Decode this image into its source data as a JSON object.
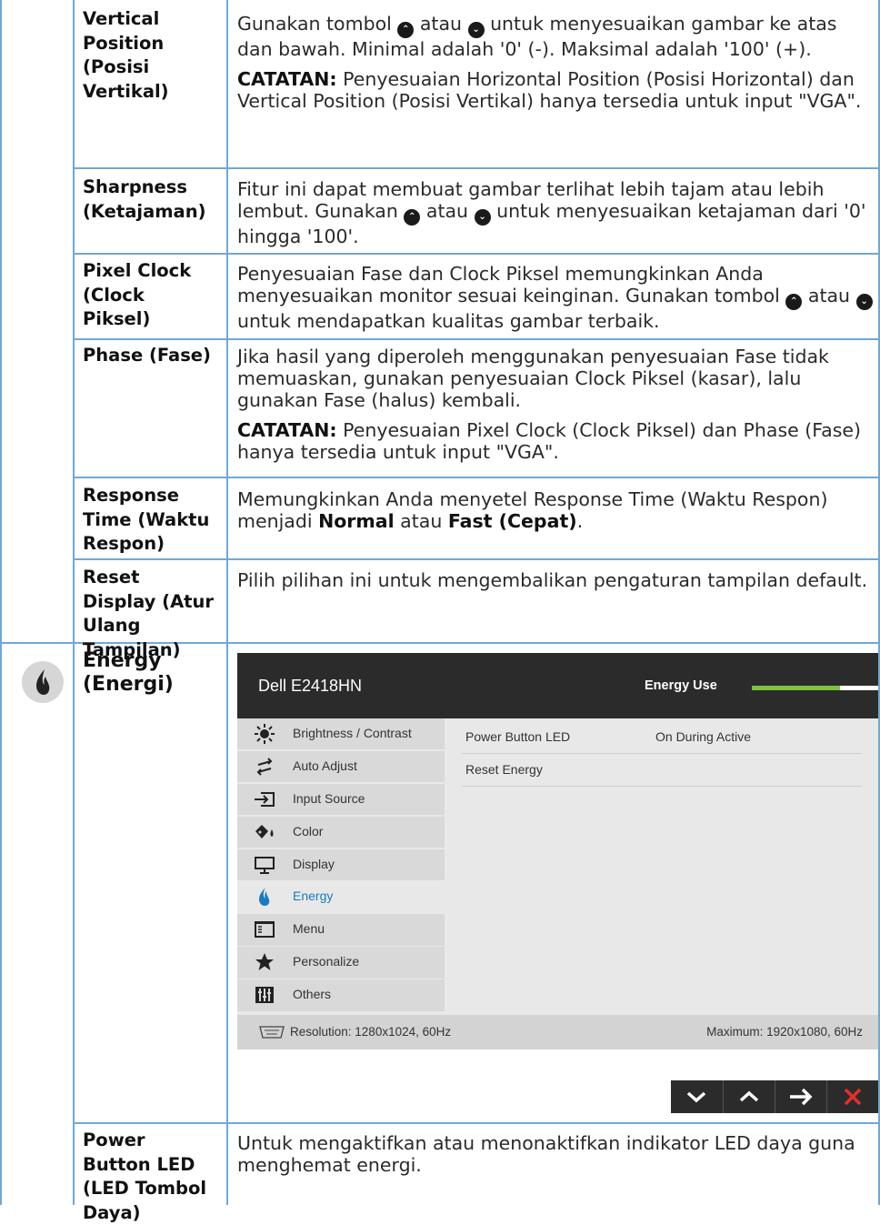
{
  "rows": [
    {
      "label": "Vertical Position (Posisi Vertikal)",
      "p1_pre": "Gunakan tombol ",
      "p1_mid": " atau ",
      "p1_post": " untuk menyesuaikan gambar ke atas dan bawah. Minimal adalah '0' (-). Maksimal adalah '100' (+).",
      "note_label": "CATATAN:",
      "note_text": " Penyesuaian Horizontal Position (Posisi Horizontal) dan Vertical Position (Posisi Vertikal) hanya tersedia untuk input \"VGA\"."
    },
    {
      "label": "Sharpness (Ketajaman)",
      "p1_pre": "Fitur ini dapat membuat gambar terlihat lebih tajam atau lebih lembut. Gunakan ",
      "p1_mid": " atau ",
      "p1_post": " untuk menyesuaikan ketajaman dari '0' hingga '100'."
    },
    {
      "label": "Pixel Clock (Clock Piksel)",
      "p1_pre": "Penyesuaian Fase dan Clock Piksel memungkinkan Anda menyesuaikan monitor sesuai keinginan. Gunakan tombol ",
      "p1_mid": " atau ",
      "p1_post": " untuk mendapatkan kualitas gambar terbaik."
    },
    {
      "label": "Phase (Fase)",
      "p1": "Jika hasil yang diperoleh menggunakan penyesuaian Fase tidak memuaskan, gunakan penyesuaian Clock Piksel (kasar), lalu gunakan Fase (halus) kembali.",
      "note_label": "CATATAN:",
      "note_text": " Penyesuaian Pixel Clock (Clock Piksel) dan Phase (Fase) hanya tersedia untuk input \"VGA\"."
    },
    {
      "label": "Response Time (Waktu Respon)",
      "p1_pre": "Memungkinkan Anda menyetel Response Time (Waktu Respon) menjadi ",
      "opt1": "Normal",
      "p1_mid": " atau ",
      "opt2": "Fast (Cepat)",
      "p1_post": "."
    },
    {
      "label": "Reset Display (Atur Ulang Tampilan)",
      "p1": "Pilih pilihan ini untuk mengembalikan pengaturan tampilan default."
    },
    {
      "label": "Energy (Energi)"
    },
    {
      "label": "Power Button LED (LED Tombol Daya)",
      "p1": "Untuk mengaktifkan atau menonaktifkan indikator LED daya guna menghemat energi."
    }
  ],
  "glyphs": {
    "up": "⌃",
    "down": "⌄"
  },
  "osd": {
    "model": "Dell E2418HN",
    "energy_use_label": "Energy Use",
    "energy_use_level": 0.7,
    "menu": [
      {
        "label": "Brightness / Contrast",
        "icon": "brightness-icon"
      },
      {
        "label": "Auto Adjust",
        "icon": "auto-adjust-icon"
      },
      {
        "label": "Input Source",
        "icon": "input-source-icon"
      },
      {
        "label": "Color",
        "icon": "color-icon"
      },
      {
        "label": "Display",
        "icon": "display-icon"
      },
      {
        "label": "Energy",
        "icon": "energy-icon",
        "active": true
      },
      {
        "label": "Menu",
        "icon": "menu-icon"
      },
      {
        "label": "Personalize",
        "icon": "star-icon"
      },
      {
        "label": "Others",
        "icon": "others-icon"
      }
    ],
    "submenu": [
      {
        "label": "Power Button LED",
        "value": "On During Active"
      },
      {
        "label": "Reset Energy",
        "value": ""
      }
    ],
    "resolution": "Resolution: 1280x1024, 60Hz",
    "maximum": "Maximum: 1920x1080, 60Hz",
    "colors": {
      "accent": "#1a7bbf",
      "energy_fill": "#7dc242",
      "exit": "#e0312a"
    }
  }
}
